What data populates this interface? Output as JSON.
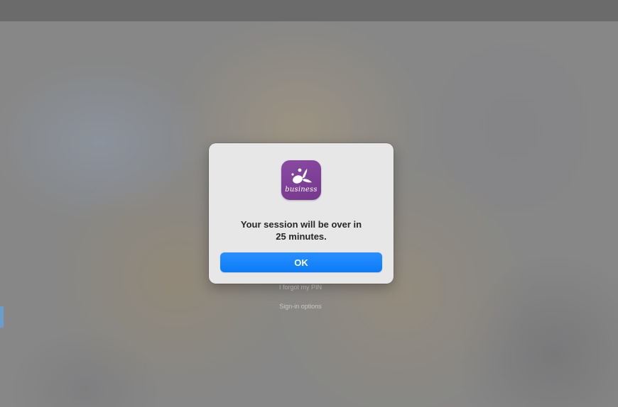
{
  "background": {
    "forgot_pin_link": "I forgot my PIN",
    "signin_options_link": "Sign-in options"
  },
  "dialog": {
    "app_icon": {
      "name": "splashtop-business-icon",
      "text": "business",
      "color": "#7b3f95"
    },
    "message_line1": "Your session will be over in",
    "message_line2": "25 minutes.",
    "ok_label": "OK",
    "accent_color": "#0a7bf7"
  }
}
